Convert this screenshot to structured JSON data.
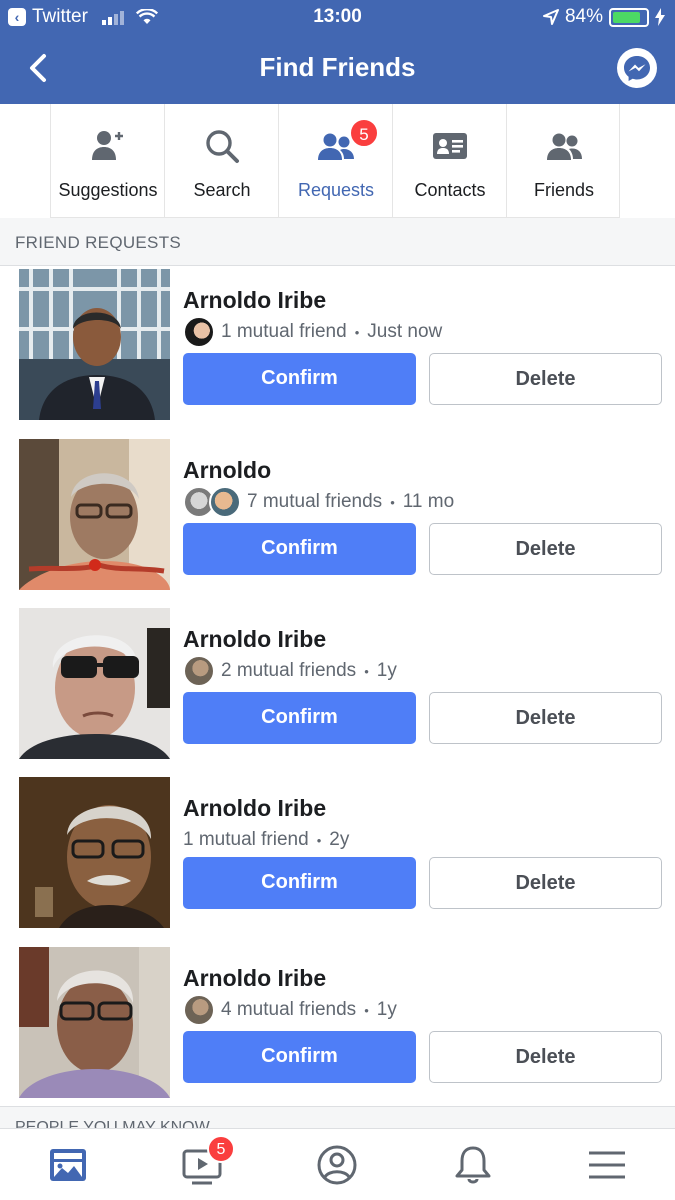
{
  "status_bar": {
    "back_app": "Twitter",
    "time": "13:00",
    "battery": "84%",
    "battery_level": 0.84
  },
  "header": {
    "title": "Find Friends"
  },
  "tabs": [
    {
      "label": "Suggestions",
      "icon": "add-person-icon"
    },
    {
      "label": "Search",
      "icon": "search-icon"
    },
    {
      "label": "Requests",
      "icon": "people-icon",
      "badge": "5",
      "active": true
    },
    {
      "label": "Contacts",
      "icon": "contact-card-icon"
    },
    {
      "label": "Friends",
      "icon": "friends-icon"
    }
  ],
  "section": {
    "title": "FRIEND REQUESTS"
  },
  "requests": [
    {
      "name": "Arnoldo Iribe",
      "mutual": "1 mutual friend",
      "time": "Just now"
    },
    {
      "name": "Arnoldo",
      "mutual": "7 mutual friends",
      "time": "11 mo"
    },
    {
      "name": "Arnoldo Iribe",
      "mutual": "2 mutual friends",
      "time": "1y"
    },
    {
      "name": "Arnoldo Iribe",
      "mutual": "1 mutual friend",
      "time": "2y"
    },
    {
      "name": "Arnoldo Iribe",
      "mutual": "4 mutual friends",
      "time": "1y"
    }
  ],
  "actions": {
    "confirm": "Confirm",
    "delete": "Delete"
  },
  "next_section": {
    "title": "PEOPLE YOU MAY KNOW"
  },
  "bottom_nav": {
    "video_badge": "5"
  },
  "colors": {
    "brand": "#4267b2",
    "confirm": "#4f7ef7",
    "badge": "#fa3e3e"
  }
}
